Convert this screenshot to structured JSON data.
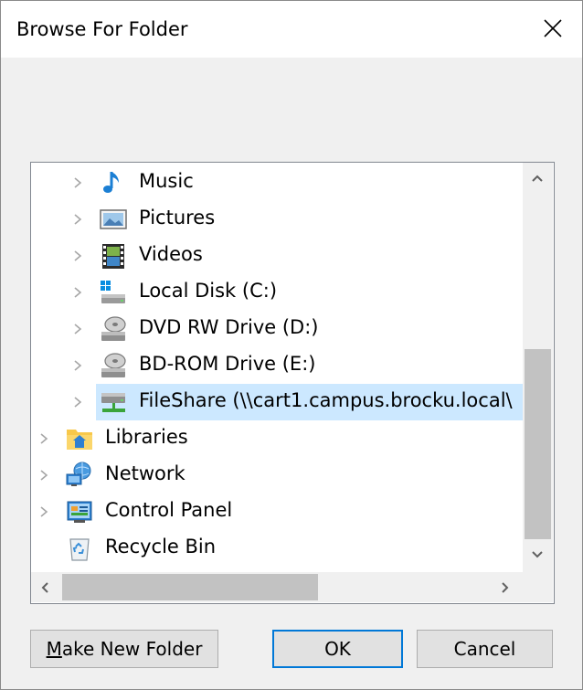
{
  "window": {
    "title": "Browse For Folder"
  },
  "tree": {
    "items": [
      {
        "label": "Music",
        "icon": "music-icon"
      },
      {
        "label": "Pictures",
        "icon": "pictures-icon"
      },
      {
        "label": "Videos",
        "icon": "videos-icon"
      },
      {
        "label": "Local Disk (C:)",
        "icon": "local-disk-icon"
      },
      {
        "label": "DVD RW Drive (D:)",
        "icon": "dvd-drive-icon"
      },
      {
        "label": "BD-ROM Drive (E:)",
        "icon": "bd-rom-drive-icon"
      },
      {
        "label": "FileShare (\\\\cart1.campus.brocku.local\\",
        "icon": "network-share-icon",
        "selected": true
      },
      {
        "label": "Libraries",
        "icon": "libraries-icon"
      },
      {
        "label": "Network",
        "icon": "network-icon"
      },
      {
        "label": "Control Panel",
        "icon": "control-panel-icon"
      },
      {
        "label": "Recycle Bin",
        "icon": "recycle-bin-icon"
      }
    ]
  },
  "buttons": {
    "make_new_folder_prefix": "M",
    "make_new_folder_rest": "ake New Folder",
    "ok": "OK",
    "cancel": "Cancel"
  },
  "colors": {
    "selection": "#cce8ff",
    "accent": "#0078d7"
  }
}
